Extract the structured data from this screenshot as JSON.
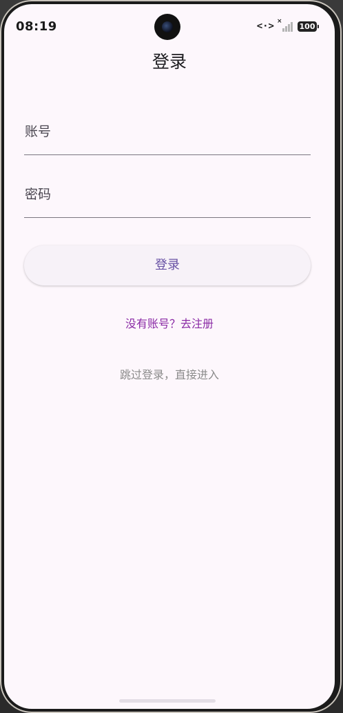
{
  "status_bar": {
    "time": "08:19",
    "data_icon": "<·>",
    "battery_level": "100",
    "signal_bars_active": 0
  },
  "header": {
    "title": "登录"
  },
  "form": {
    "account_label": "账号",
    "password_label": "密码",
    "login_button_label": "登录"
  },
  "links": {
    "register": "没有账号？去注册",
    "skip": "跳过登录，直接进入"
  },
  "colors": {
    "background": "#fdf7fc",
    "primary": "#6750a4",
    "link": "#8a2aa5",
    "muted": "#8a8a8a"
  }
}
